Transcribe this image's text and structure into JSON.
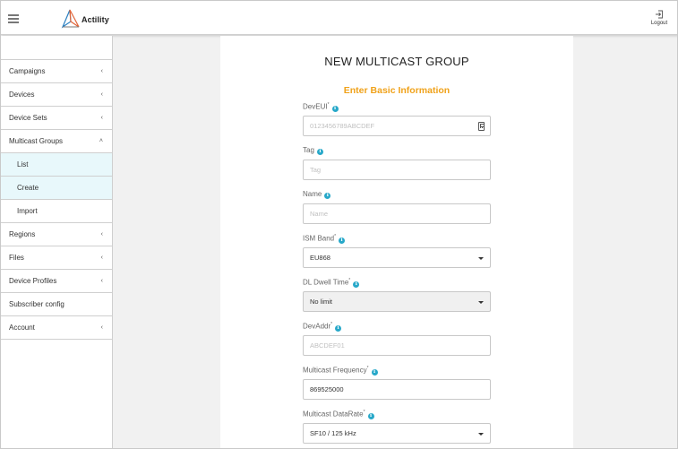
{
  "header": {
    "brand": "Actility",
    "logout_label": "Logout"
  },
  "sidebar": {
    "items": [
      {
        "label": "Campaigns"
      },
      {
        "label": "Devices"
      },
      {
        "label": "Device Sets"
      },
      {
        "label": "Multicast Groups"
      },
      {
        "label": "List"
      },
      {
        "label": "Create"
      },
      {
        "label": "Import"
      },
      {
        "label": "Regions"
      },
      {
        "label": "Files"
      },
      {
        "label": "Device Profiles"
      },
      {
        "label": "Subscriber config"
      },
      {
        "label": "Account"
      }
    ],
    "chevron_collapsed": "‹",
    "chevron_expanded": "˄"
  },
  "form": {
    "title": "NEW MULTICAST GROUP",
    "subtitle": "Enter Basic Information",
    "accent_color": "#f0a21a",
    "info_color": "#27a8c9",
    "fields": {
      "deveui": {
        "label": "DevEUI",
        "required": "*",
        "placeholder": "0123456789ABCDEF"
      },
      "tag": {
        "label": "Tag",
        "placeholder": "Tag"
      },
      "name": {
        "label": "Name",
        "placeholder": "Name"
      },
      "ism_band": {
        "label": "ISM Band",
        "required": "*",
        "value": "EU868"
      },
      "dl_dwell_time": {
        "label": "DL Dwell Time",
        "required": "*",
        "value": "No limit"
      },
      "devaddr": {
        "label": "DevAddr",
        "required": "*",
        "placeholder": "ABCDEF01"
      },
      "multicast_frequency": {
        "label": "Multicast Frequency",
        "required": "*",
        "value": "869525000"
      },
      "multicast_datarate": {
        "label": "Multicast DataRate",
        "required": "*",
        "value": "SF10 / 125 kHz"
      }
    },
    "info_glyph": "i"
  }
}
